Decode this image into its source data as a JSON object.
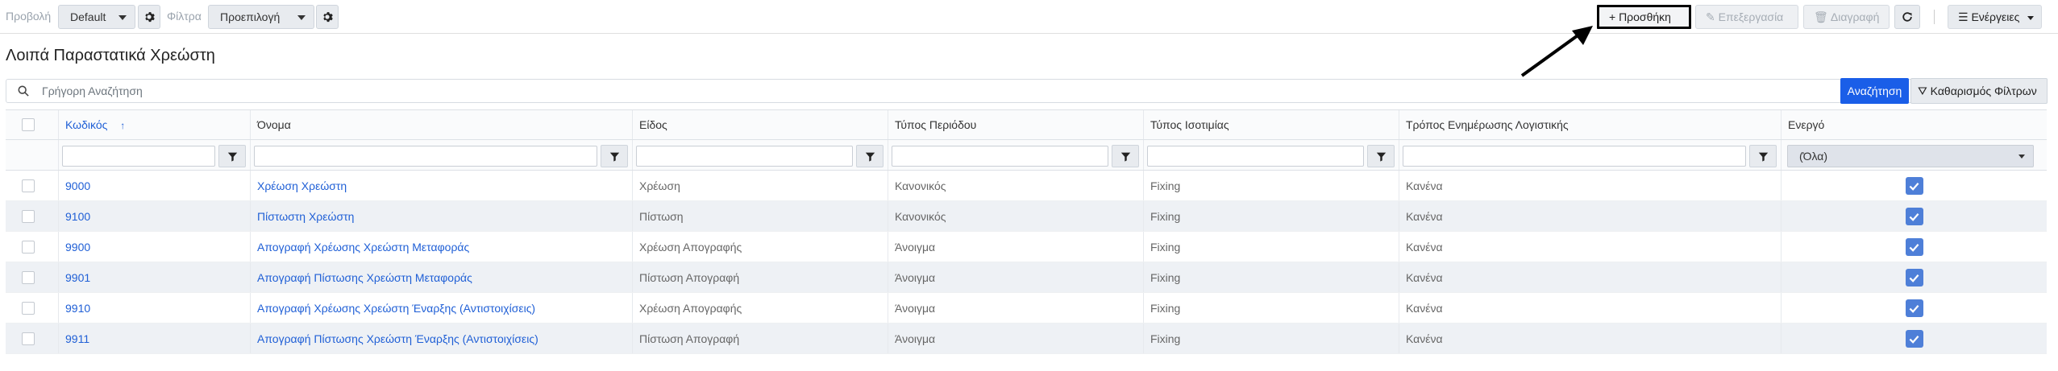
{
  "toolbar": {
    "view_label": "Προβολή",
    "view_value": "Default",
    "filter_label": "Φίλτρα",
    "filter_value": "Προεπιλογή",
    "add_label": "+ Προσθήκη",
    "edit_label": "Επεξεργασία",
    "delete_label": "Διαγραφή",
    "actions_label": "Ενέργειες"
  },
  "page": {
    "title": "Λοιπά Παραστατικά Χρεώστη"
  },
  "search": {
    "placeholder": "Γρήγορη Αναζήτηση",
    "search_button": "Αναζήτηση",
    "clear_button": "Καθαρισμός Φίλτρων"
  },
  "table": {
    "columns": [
      "Κωδικός",
      "Όνομα",
      "Είδος",
      "Τύπος Περιόδου",
      "Τύπος Ισοτιμίας",
      "Τρόπος Ενημέρωσης Λογιστικής",
      "Ενεργό"
    ],
    "sort_indicator": "↑",
    "active_filter_value": "(Όλα)",
    "rows": [
      {
        "code": "9000",
        "name": "Χρέωση Χρεώστη",
        "kind": "Χρέωση",
        "period": "Κανονικός",
        "rate": "Fixing",
        "accounting": "Κανένα"
      },
      {
        "code": "9100",
        "name": "Πίστωστη Χρεώστη",
        "kind": "Πίστωση",
        "period": "Κανονικός",
        "rate": "Fixing",
        "accounting": "Κανένα"
      },
      {
        "code": "9900",
        "name": "Απογραφή Χρέωσης Χρεώστη Μεταφοράς",
        "kind": "Χρέωση Απογραφής",
        "period": "Άνοιγμα",
        "rate": "Fixing",
        "accounting": "Κανένα"
      },
      {
        "code": "9901",
        "name": "Απογραφή Πίστωσης Χρεώστη Μεταφοράς",
        "kind": "Πίστωση Απογραφή",
        "period": "Άνοιγμα",
        "rate": "Fixing",
        "accounting": "Κανένα"
      },
      {
        "code": "9910",
        "name": "Απογραφή Χρέωσης Χρεώστη Έναρξης (Αντιστοιχίσεις)",
        "kind": "Χρέωση Απογραφής",
        "period": "Άνοιγμα",
        "rate": "Fixing",
        "accounting": "Κανένα"
      },
      {
        "code": "9911",
        "name": "Απογραφή Πίστωσης Χρεώστη Έναρξης (Αντιστοιχίσεις)",
        "kind": "Πίστωση Απογραφή",
        "period": "Άνοιγμα",
        "rate": "Fixing",
        "accounting": "Κανένα"
      }
    ]
  },
  "colors": {
    "accent": "#1a5ee8",
    "link": "#1f5fd6",
    "check": "#4e7fd8"
  }
}
